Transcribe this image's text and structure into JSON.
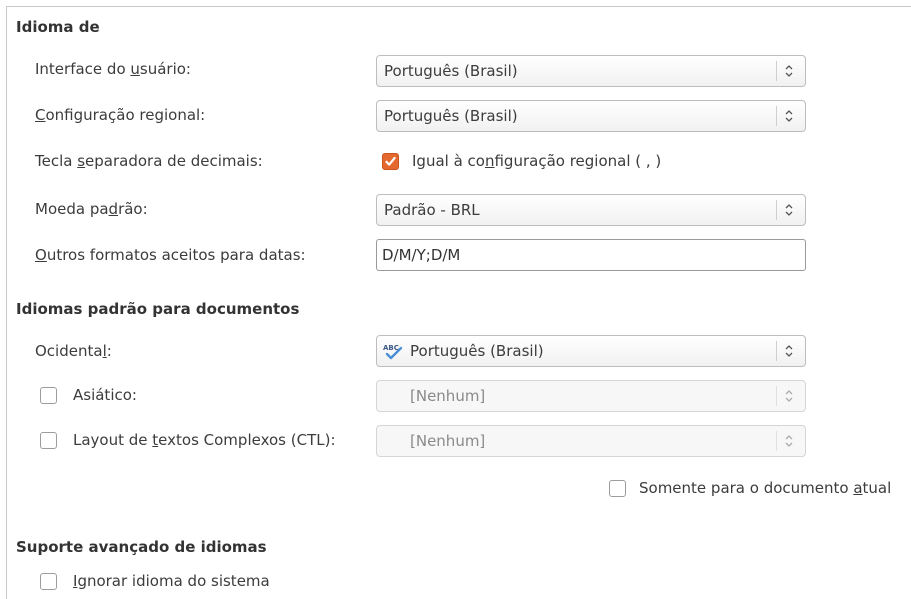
{
  "section_language_of": {
    "heading": "Idioma de",
    "ui_label": [
      "Interface do ",
      "u",
      "suário:"
    ],
    "ui_value": "Português (Brasil)",
    "locale_label": [
      "C",
      "onfiguração regional:"
    ],
    "locale_value": "Português (Brasil)",
    "decimal_label": [
      "Tecla ",
      "s",
      "eparadora de decimais:"
    ],
    "decimal_checkbox_label": [
      "Igual à co",
      "n",
      "figuração regional ( , )"
    ],
    "decimal_checked": true,
    "currency_label": [
      "Moeda pa",
      "d",
      "rão:"
    ],
    "currency_value": "Padrão - BRL",
    "dates_label": [
      "O",
      "utros formatos aceitos para datas:"
    ],
    "dates_value": "D/M/Y;D/M"
  },
  "section_default_langs": {
    "heading": "Idiomas padrão para documentos",
    "western_label": [
      "Ocidenta",
      "l",
      ":"
    ],
    "western_value": "Português (Brasil)",
    "western_icon": "spellcheck-abc-icon",
    "asian_label": "Asiático:",
    "asian_value": "[Nenhum]",
    "asian_checked": false,
    "ctl_label": [
      "Layout de ",
      "t",
      "extos Complexos (CTL):"
    ],
    "ctl_value": "[Nenhum]",
    "ctl_checked": false,
    "current_doc_label": [
      "Somente para o documento ",
      "a",
      "tual"
    ],
    "current_doc_checked": false
  },
  "section_advanced": {
    "heading": "Suporte avançado de idiomas",
    "ignore_label": [
      "I",
      "gnorar idioma do sistema"
    ],
    "ignore_checked": false
  },
  "colors": {
    "checkbox_checked": "#e5682e",
    "text": "#3c3c3c",
    "disabled_text": "#8a8a8a"
  }
}
